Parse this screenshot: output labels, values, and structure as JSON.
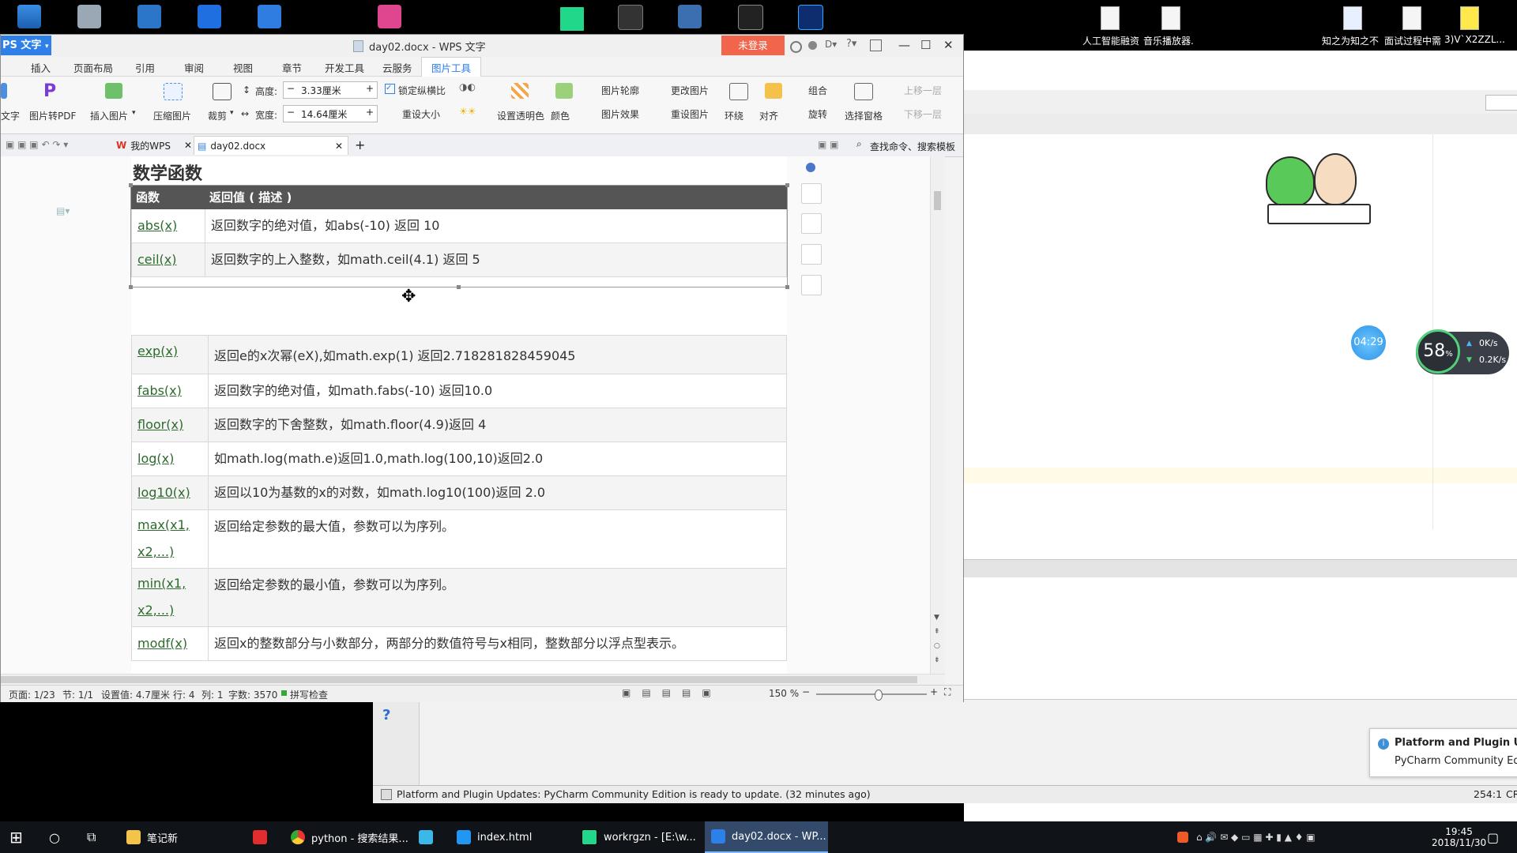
{
  "desktop": {
    "files": [
      {
        "label": "人工智能融资"
      },
      {
        "label": "音乐播放器."
      },
      {
        "label": "知之为知之不"
      },
      {
        "label": "面试过程中需"
      },
      {
        "label": "3)V`X2ZZL..."
      }
    ]
  },
  "wps": {
    "app_name": "PS 文字",
    "doc_title": "day02.docx - WPS 文字",
    "login_button": "未登录",
    "ribbon_tabs": [
      "插入",
      "页面布局",
      "引用",
      "审阅",
      "视图",
      "章节",
      "开发工具",
      "云服务",
      "图片工具"
    ],
    "active_ribbon_tab": "图片工具",
    "ribbon": {
      "wrap_text": "文字",
      "to_pdf": "图片转PDF",
      "insert_picture": "插入图片",
      "compress": "压缩图片",
      "crop": "裁剪",
      "height_label": "高度:",
      "height_value": "3.33厘米",
      "width_label": "宽度:",
      "width_value": "14.64厘米",
      "lock_ratio": "锁定纵横比",
      "reset_size": "重设大小",
      "set_transparent": "设置透明色",
      "color": "颜色",
      "outline": "图片轮廓",
      "effects": "图片效果",
      "change_picture": "更改图片",
      "reset_picture": "重设图片",
      "wrap": "环绕",
      "align": "对齐",
      "group": "组合",
      "rotate": "旋转",
      "selection_pane": "选择窗格",
      "bring_forward": "上移一层",
      "send_backward": "下移一层"
    },
    "doc_tabs": {
      "home": "我的WPS",
      "doc": "day02.docx",
      "search": "查找命令、搜索模板"
    },
    "content": {
      "heading": "数学函数",
      "col_func": "函数",
      "col_desc": "返回值 ( 描述 )",
      "rows_top": [
        {
          "func": "abs(x)",
          "desc": "返回数字的绝对值，如abs(-10) 返回 10"
        },
        {
          "func": "ceil(x)",
          "desc": "返回数字的上入整数，如math.ceil(4.1) 返回 5"
        }
      ],
      "rows": [
        {
          "func": "exp(x)",
          "desc": "返回e的x次幂(eX),如math.exp(1) 返回2.718281828459045"
        },
        {
          "func": "fabs(x)",
          "desc": "返回数字的绝对值，如math.fabs(-10) 返回10.0"
        },
        {
          "func": "floor(x)",
          "desc": "返回数字的下舍整数，如math.floor(4.9)返回 4"
        },
        {
          "func": "log(x)",
          "desc": "如math.log(math.e)返回1.0,math.log(100,10)返回2.0"
        },
        {
          "func": "log10(x)",
          "desc": "返回以10为基数的x的对数，如math.log10(100)返回 2.0"
        },
        {
          "func": "max(x1, x2,...)",
          "desc": "返回给定参数的最大值，参数可以为序列。"
        },
        {
          "func": "min(x1, x2,...)",
          "desc": "返回给定参数的最小值，参数可以为序列。"
        },
        {
          "func": "modf(x)",
          "desc": "返回x的整数部分与小数部分，两部分的数值符号与x相同，整数部分以浮点型表示。"
        }
      ]
    },
    "status": {
      "page": "页面: 1/23",
      "section": "节: 1/1",
      "setting": "设置值: 4.7厘米",
      "row": "行: 4",
      "col": "列: 1",
      "words": "字数: 3570",
      "spell": "拼写检查",
      "zoom": "150 %"
    }
  },
  "widgets": {
    "timer": "04:29",
    "cpu": "58",
    "cpu_unit": "%",
    "net_up": "0K/s",
    "net_down": "0.2K/s"
  },
  "pycharm": {
    "status_text": "Platform and Plugin Updates: PyCharm Community Edition is ready to update. (32 minutes ago)",
    "position": "254:1",
    "cr": "CR",
    "notif_title": "Platform and Plugin Upd",
    "notif_body": "PyCharm Community Editic",
    "help_icon": "?"
  },
  "taskbar": {
    "items": [
      "笔记新",
      "python - 搜索结果...",
      "index.html",
      "workrgzn - [E:\\w...",
      "day02.docx - WP..."
    ],
    "time": "19:45",
    "date": "2018/11/30"
  }
}
